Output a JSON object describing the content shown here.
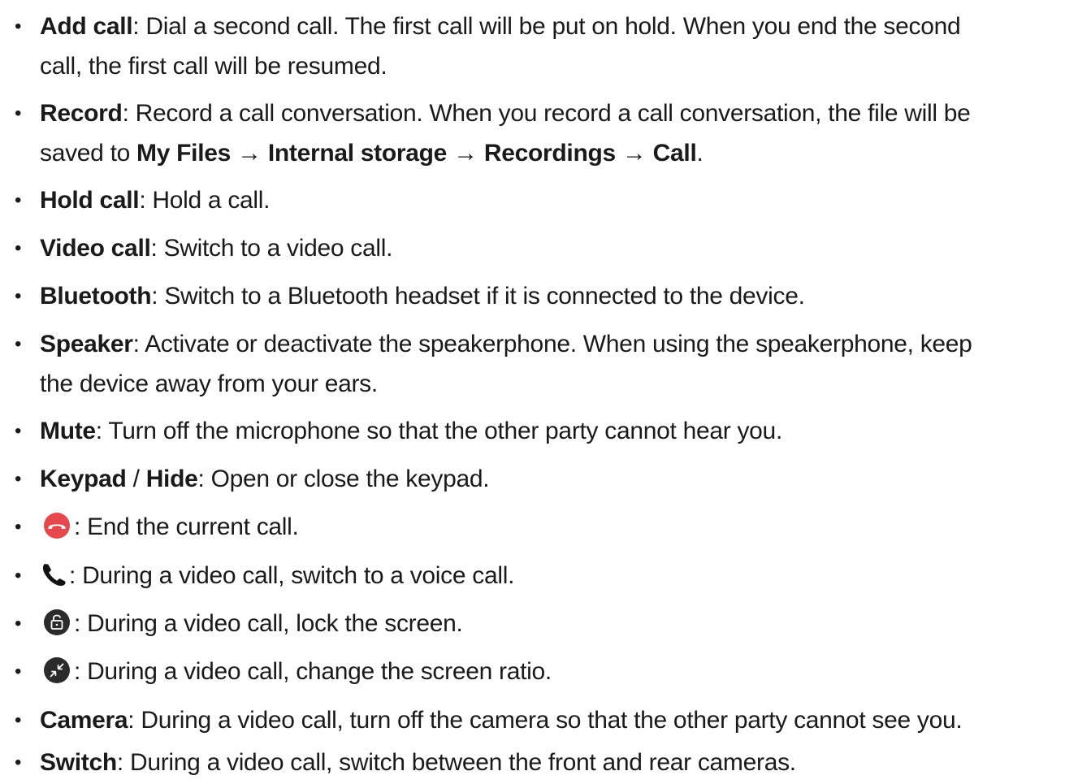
{
  "items": [
    {
      "term": "Add call",
      "desc_line1": ": Dial a second call. The first call will be put on hold. When you end the second",
      "desc_line2": "call, the first call will be resumed."
    },
    {
      "term": "Record",
      "desc_line1": ": Record a call conversation. When you record a call conversation, the file will be",
      "desc_line2_prefix": "saved to ",
      "path": [
        "My Files",
        "Internal storage",
        "Recordings",
        "Call"
      ],
      "path_separator": " → ",
      "desc_line2_suffix": "."
    },
    {
      "term": "Hold call",
      "desc": ": Hold a call."
    },
    {
      "term": "Video call",
      "desc": ": Switch to a video call."
    },
    {
      "term": "Bluetooth",
      "desc": ": Switch to a Bluetooth headset if it is connected to the device."
    },
    {
      "term": "Speaker",
      "desc_line1": ": Activate or deactivate the speakerphone. When using the speakerphone, keep",
      "desc_line2": "the device away from your ears."
    },
    {
      "term": "Mute",
      "desc": ": Turn off the microphone so that the other party cannot hear you."
    },
    {
      "term": "Keypad",
      "sep": " / ",
      "term2": "Hide",
      "desc": ": Open or close the keypad."
    },
    {
      "icon": "end-call-icon",
      "desc": ": End the current call."
    },
    {
      "icon": "voice-call-icon",
      "desc": ": During a video call, switch to a voice call."
    },
    {
      "icon": "lock-screen-icon",
      "desc": ": During a video call, lock the screen."
    },
    {
      "icon": "screen-ratio-icon",
      "desc": ": During a video call, change the screen ratio."
    },
    {
      "term": "Camera",
      "desc": ": During a video call, turn off the camera so that the other party cannot see you."
    },
    {
      "term": "Switch",
      "desc": ": During a video call, switch between the front and rear cameras."
    }
  ],
  "bullet_symbol": "•",
  "colors": {
    "text": "#1a1a1a",
    "end_call_red": "#e5484d",
    "icon_dark": "#2b2b2b"
  }
}
